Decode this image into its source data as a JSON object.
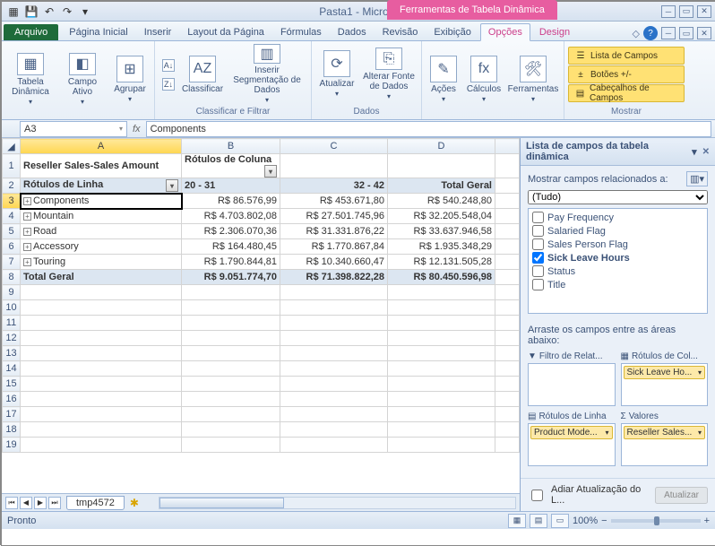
{
  "title": {
    "doc": "Pasta1",
    "app": "Microsoft Excel",
    "context": "Ferramentas de Tabela Dinâmica"
  },
  "tabs": {
    "file": "Arquivo",
    "list": [
      "Página Inicial",
      "Inserir",
      "Layout da Página",
      "Fórmulas",
      "Dados",
      "Revisão",
      "Exibição"
    ],
    "ctx": [
      "Opções",
      "Design"
    ],
    "activeIdx": 0
  },
  "ribbon": {
    "g1": [
      "Tabela Dinâmica",
      "Campo Ativo",
      "Agrupar"
    ],
    "g2": {
      "label": "Classificar e Filtrar",
      "sort": "Classificar",
      "slicer": "Inserir Segmentação de Dados"
    },
    "g3": {
      "label": "Dados",
      "refresh": "Atualizar",
      "src": "Alterar Fonte de Dados"
    },
    "g4": [
      "Ações",
      "Cálculos",
      "Ferramentas"
    ],
    "g5": {
      "label": "Mostrar",
      "b1": "Lista de Campos",
      "b2": "Botões +/-",
      "b3": "Cabeçalhos de Campos"
    }
  },
  "namebox": "A3",
  "formula": "Components",
  "cols": [
    "A",
    "B",
    "C",
    "D"
  ],
  "r1": {
    "a": "Reseller Sales-Sales Amount",
    "b": "Rótulos de Coluna"
  },
  "r2": {
    "a": "Rótulos de Linha",
    "b": "20 - 31",
    "c": "32 - 42",
    "d": "Total Geral"
  },
  "rows": [
    {
      "n": "3",
      "a": "Components",
      "b": "R$ 86.576,99",
      "c": "R$ 453.671,80",
      "d": "R$ 540.248,80"
    },
    {
      "n": "4",
      "a": "Mountain",
      "b": "R$ 4.703.802,08",
      "c": "R$ 27.501.745,96",
      "d": "R$ 32.205.548,04"
    },
    {
      "n": "5",
      "a": "Road",
      "b": "R$ 2.306.070,36",
      "c": "R$ 31.331.876,22",
      "d": "R$ 33.637.946,58"
    },
    {
      "n": "6",
      "a": "Accessory",
      "b": "R$ 164.480,45",
      "c": "R$ 1.770.867,84",
      "d": "R$ 1.935.348,29"
    },
    {
      "n": "7",
      "a": "Touring",
      "b": "R$ 1.790.844,81",
      "c": "R$ 10.340.660,47",
      "d": "R$ 12.131.505,28"
    }
  ],
  "total": {
    "n": "8",
    "a": "Total Geral",
    "b": "R$ 9.051.774,70",
    "c": "R$ 71.398.822,28",
    "d": "R$ 80.450.596,98"
  },
  "sheet": "tmp4572",
  "pane": {
    "title": "Lista de campos da tabela dinâmica",
    "show": "Mostrar campos relacionados a:",
    "sel": "(Tudo)",
    "fields": [
      {
        "l": "Pay Frequency",
        "c": false
      },
      {
        "l": "Salaried Flag",
        "c": false
      },
      {
        "l": "Sales Person Flag",
        "c": false
      },
      {
        "l": "Sick Leave Hours",
        "c": true,
        "b": true
      },
      {
        "l": "Status",
        "c": false
      },
      {
        "l": "Title",
        "c": false
      }
    ],
    "drag": "Arraste os campos entre as áreas abaixo:",
    "areas": {
      "filter": "Filtro de Relat...",
      "cols": "Rótulos de Col...",
      "rows": "Rótulos de Linha",
      "vals": "Valores"
    },
    "pills": {
      "cols": "Sick Leave Ho...",
      "rows": "Product Mode...",
      "vals": "Reseller Sales..."
    },
    "defer": "Adiar Atualização do L...",
    "update": "Atualizar"
  },
  "status": "Pronto",
  "zoom": "100%"
}
